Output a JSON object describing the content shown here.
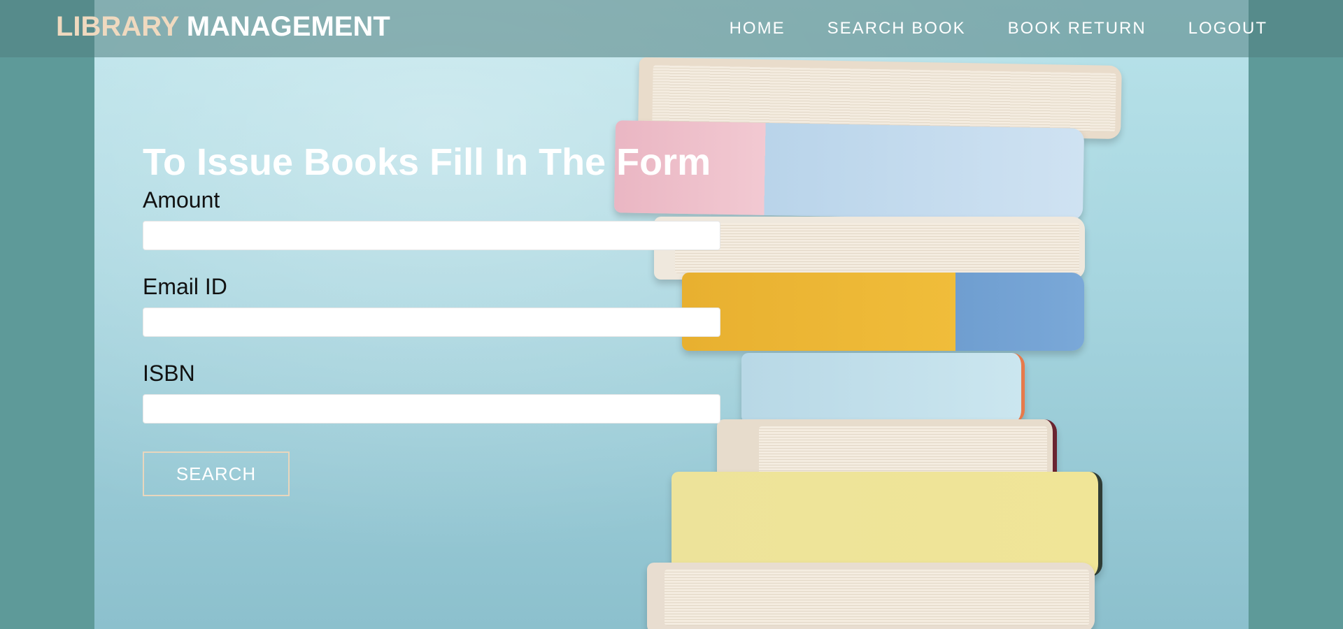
{
  "brand": {
    "accent": "LIBRARY",
    "main": "MANAGEMENT"
  },
  "nav": {
    "items": [
      {
        "label": "HOME"
      },
      {
        "label": "SEARCH BOOK"
      },
      {
        "label": "BOOK RETURN"
      },
      {
        "label": "LOGOUT"
      }
    ]
  },
  "form": {
    "title": "To Issue Books Fill In The Form",
    "fields": [
      {
        "label": "Amount",
        "value": "",
        "placeholder": ""
      },
      {
        "label": "Email ID",
        "value": "",
        "placeholder": ""
      },
      {
        "label": "ISBN",
        "value": "",
        "placeholder": ""
      }
    ],
    "submit_label": "SEARCH"
  },
  "colors": {
    "page_background": "#5e9a99",
    "header_background": "#508080",
    "brand_accent": "#efd9bf",
    "text_white": "#ffffff",
    "button_border": "#e8d6bd"
  },
  "background_image": "stack-of-books-photo"
}
